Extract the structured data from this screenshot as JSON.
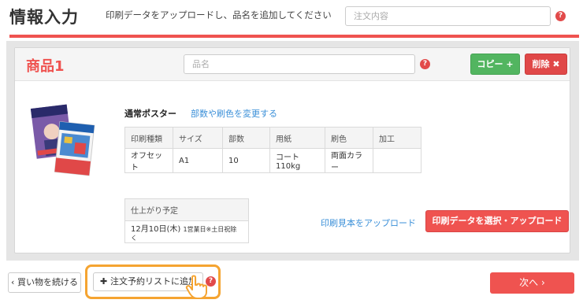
{
  "header": {
    "title": "情報入力",
    "subtitle": "印刷データをアップロードし、品名を追加してください",
    "order_placeholder": "注文内容"
  },
  "product": {
    "title": "商品1",
    "name_placeholder": "品名",
    "copy_label": "コピー",
    "delete_label": "削除",
    "poster_type": "通常ポスター",
    "change_link": "部数や刷色を変更する",
    "spec_headers": [
      "印刷種類",
      "サイズ",
      "部数",
      "用紙",
      "刷色",
      "加工"
    ],
    "spec_values": [
      "オフセット",
      "A1",
      "10",
      "コート110kg",
      "両面カラー",
      ""
    ],
    "delivery_header": "仕上がり予定",
    "delivery_value": "12月10日(木)",
    "delivery_note": "1営業日※土日祝除く",
    "sample_link": "印刷見本をアップロード",
    "select_data_label": "印刷データを選択・アップロード"
  },
  "footer": {
    "back_label": "買い物を続ける",
    "add_list_label": "注文予約リストに追加",
    "next_label": "次へ"
  },
  "icons": {
    "help": "question-circle-icon",
    "plus": "plus-icon",
    "close": "x-icon",
    "chevron_left": "chevron-left-icon",
    "chevron_right": "chevron-right-icon",
    "hand_cursor": "hand-pointer-icon"
  },
  "colors": {
    "accent": "#ef5350",
    "green": "#52b560",
    "link": "#3a8fd8",
    "highlight": "#f5a431"
  }
}
